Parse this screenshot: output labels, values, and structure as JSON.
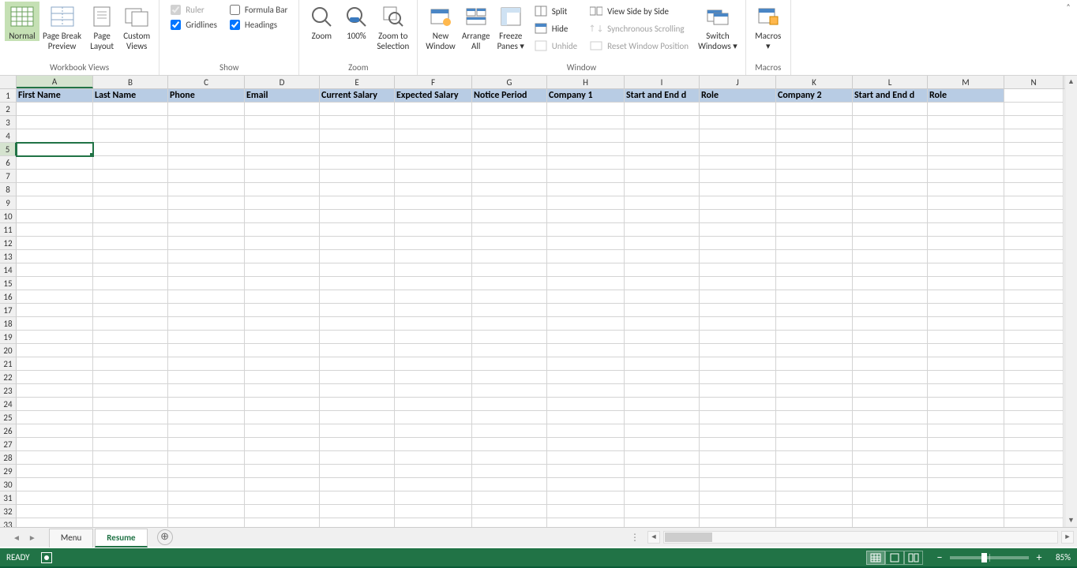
{
  "ribbon": {
    "groups": {
      "workbook_views": {
        "label": "Workbook Views",
        "normal": "Normal",
        "page_break": "Page Break\nPreview",
        "page_layout": "Page\nLayout",
        "custom_views": "Custom\nViews"
      },
      "show": {
        "label": "Show",
        "ruler": "Ruler",
        "formula_bar": "Formula Bar",
        "gridlines": "Gridlines",
        "headings": "Headings"
      },
      "zoom": {
        "label": "Zoom",
        "zoom": "Zoom",
        "pct100": "100%",
        "zoom_to_selection": "Zoom to\nSelection"
      },
      "window": {
        "label": "Window",
        "new_window": "New\nWindow",
        "arrange_all": "Arrange\nAll",
        "freeze_panes": "Freeze\nPanes ▾",
        "split": "Split",
        "hide": "Hide",
        "unhide": "Unhide",
        "view_side": "View Side by Side",
        "sync_scroll": "Synchronous Scrolling",
        "reset_pos": "Reset Window Position",
        "switch_windows": "Switch\nWindows ▾"
      },
      "macros": {
        "label": "Macros",
        "macros": "Macros\n▾"
      }
    }
  },
  "columns": [
    {
      "letter": "A",
      "w": 97,
      "header": "First Name"
    },
    {
      "letter": "B",
      "w": 95,
      "header": "Last Name"
    },
    {
      "letter": "C",
      "w": 97,
      "header": "Phone"
    },
    {
      "letter": "D",
      "w": 95,
      "header": "Email"
    },
    {
      "letter": "E",
      "w": 95,
      "header": "Current Salary"
    },
    {
      "letter": "F",
      "w": 98,
      "header": "Expected Salary"
    },
    {
      "letter": "G",
      "w": 95,
      "header": "Notice Period"
    },
    {
      "letter": "H",
      "w": 98,
      "header": "Company 1"
    },
    {
      "letter": "I",
      "w": 95,
      "header": "Start and End d"
    },
    {
      "letter": "J",
      "w": 97,
      "header": "Role"
    },
    {
      "letter": "K",
      "w": 97,
      "header": "Company 2"
    },
    {
      "letter": "L",
      "w": 95,
      "header": "Start and End d"
    },
    {
      "letter": "M",
      "w": 97,
      "header": "Role"
    },
    {
      "letter": "N",
      "w": 75,
      "header": ""
    }
  ],
  "row_count": 33,
  "selected_cell": {
    "row": 5,
    "col": "A"
  },
  "tabs": {
    "sheets": [
      {
        "name": "Menu",
        "active": false
      },
      {
        "name": "Resume",
        "active": true
      }
    ],
    "nav_prev": "◄",
    "nav_next": "►",
    "new": "⊕"
  },
  "status": {
    "ready": "READY",
    "zoom_pct": "85%"
  }
}
